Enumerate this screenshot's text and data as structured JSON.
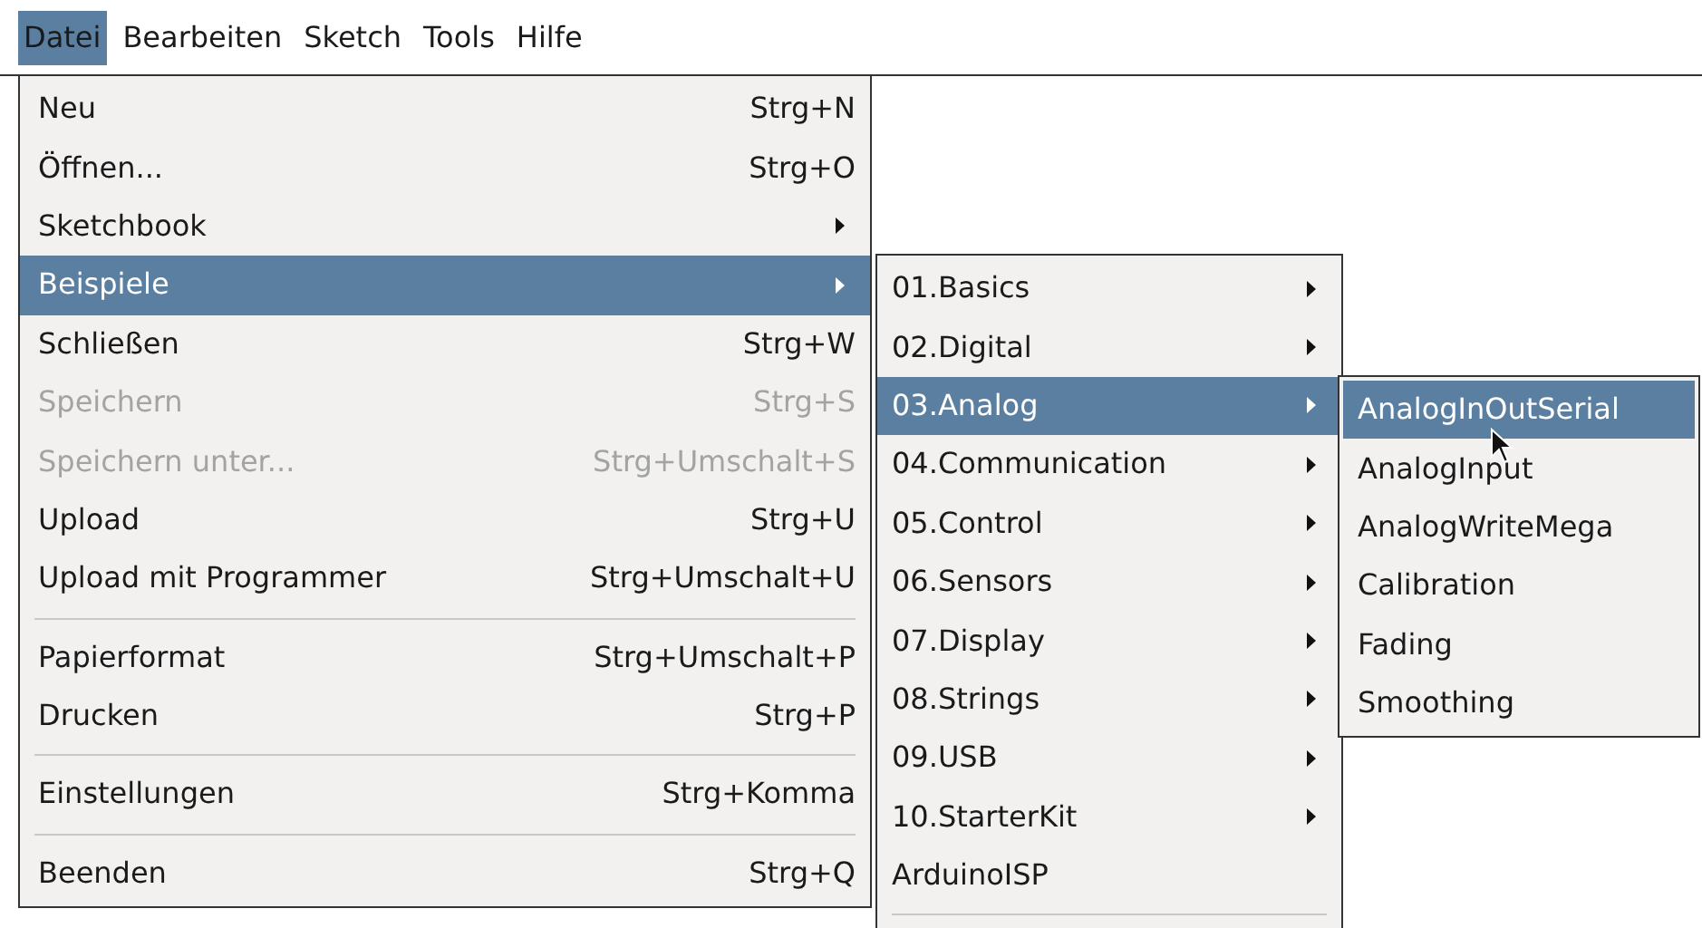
{
  "menubar": [
    {
      "label": "Datei",
      "selected": true
    },
    {
      "label": "Bearbeiten",
      "selected": false
    },
    {
      "label": "Sketch",
      "selected": false
    },
    {
      "label": "Tools",
      "selected": false
    },
    {
      "label": "Hilfe",
      "selected": false
    }
  ],
  "file_menu": [
    {
      "kind": "item",
      "label": "Neu",
      "shortcut": "Strg+N",
      "submenu": false,
      "disabled": false,
      "selected": false
    },
    {
      "kind": "item",
      "label": "Öffnen...",
      "shortcut": "Strg+O",
      "submenu": false,
      "disabled": false,
      "selected": false
    },
    {
      "kind": "item",
      "label": "Sketchbook",
      "submenu": true,
      "disabled": false,
      "selected": false
    },
    {
      "kind": "item",
      "label": "Beispiele",
      "submenu": true,
      "disabled": false,
      "selected": true
    },
    {
      "kind": "item",
      "label": "Schließen",
      "shortcut": "Strg+W",
      "submenu": false,
      "disabled": false,
      "selected": false
    },
    {
      "kind": "item",
      "label": "Speichern",
      "shortcut": "Strg+S",
      "submenu": false,
      "disabled": true,
      "selected": false
    },
    {
      "kind": "item",
      "label": "Speichern unter...",
      "shortcut": "Strg+Umschalt+S",
      "submenu": false,
      "disabled": true,
      "selected": false
    },
    {
      "kind": "item",
      "label": "Upload",
      "shortcut": "Strg+U",
      "submenu": false,
      "disabled": false,
      "selected": false
    },
    {
      "kind": "item",
      "label": "Upload mit Programmer",
      "shortcut": "Strg+Umschalt+U",
      "submenu": false,
      "disabled": false,
      "selected": false
    },
    {
      "kind": "separator"
    },
    {
      "kind": "item",
      "label": "Papierformat",
      "shortcut": "Strg+Umschalt+P",
      "submenu": false,
      "disabled": false,
      "selected": false
    },
    {
      "kind": "item",
      "label": "Drucken",
      "shortcut": "Strg+P",
      "submenu": false,
      "disabled": false,
      "selected": false
    },
    {
      "kind": "separator"
    },
    {
      "kind": "item",
      "label": "Einstellungen",
      "shortcut": "Strg+Komma",
      "submenu": false,
      "disabled": false,
      "selected": false
    },
    {
      "kind": "separator"
    },
    {
      "kind": "item",
      "label": "Beenden",
      "shortcut": "Strg+Q",
      "submenu": false,
      "disabled": false,
      "selected": false
    }
  ],
  "examples_menu": [
    {
      "kind": "item",
      "label": "01.Basics",
      "submenu": true,
      "selected": false
    },
    {
      "kind": "item",
      "label": "02.Digital",
      "submenu": true,
      "selected": false
    },
    {
      "kind": "item",
      "label": "03.Analog",
      "submenu": true,
      "selected": true
    },
    {
      "kind": "item",
      "label": "04.Communication",
      "submenu": true,
      "selected": false
    },
    {
      "kind": "item",
      "label": "05.Control",
      "submenu": true,
      "selected": false
    },
    {
      "kind": "item",
      "label": "06.Sensors",
      "submenu": true,
      "selected": false
    },
    {
      "kind": "item",
      "label": "07.Display",
      "submenu": true,
      "selected": false
    },
    {
      "kind": "item",
      "label": "08.Strings",
      "submenu": true,
      "selected": false
    },
    {
      "kind": "item",
      "label": "09.USB",
      "submenu": true,
      "selected": false
    },
    {
      "kind": "item",
      "label": "10.StarterKit",
      "submenu": true,
      "selected": false
    },
    {
      "kind": "item",
      "label": "ArduinoISP",
      "submenu": false,
      "selected": false
    },
    {
      "kind": "separator"
    }
  ],
  "analog_menu": [
    {
      "label": "AnalogInOutSerial",
      "selected": true
    },
    {
      "label": "AnalogInput",
      "selected": false
    },
    {
      "label": "AnalogWriteMega",
      "selected": false
    },
    {
      "label": "Calibration",
      "selected": false
    },
    {
      "label": "Fading",
      "selected": false
    },
    {
      "label": "Smoothing",
      "selected": false
    }
  ]
}
